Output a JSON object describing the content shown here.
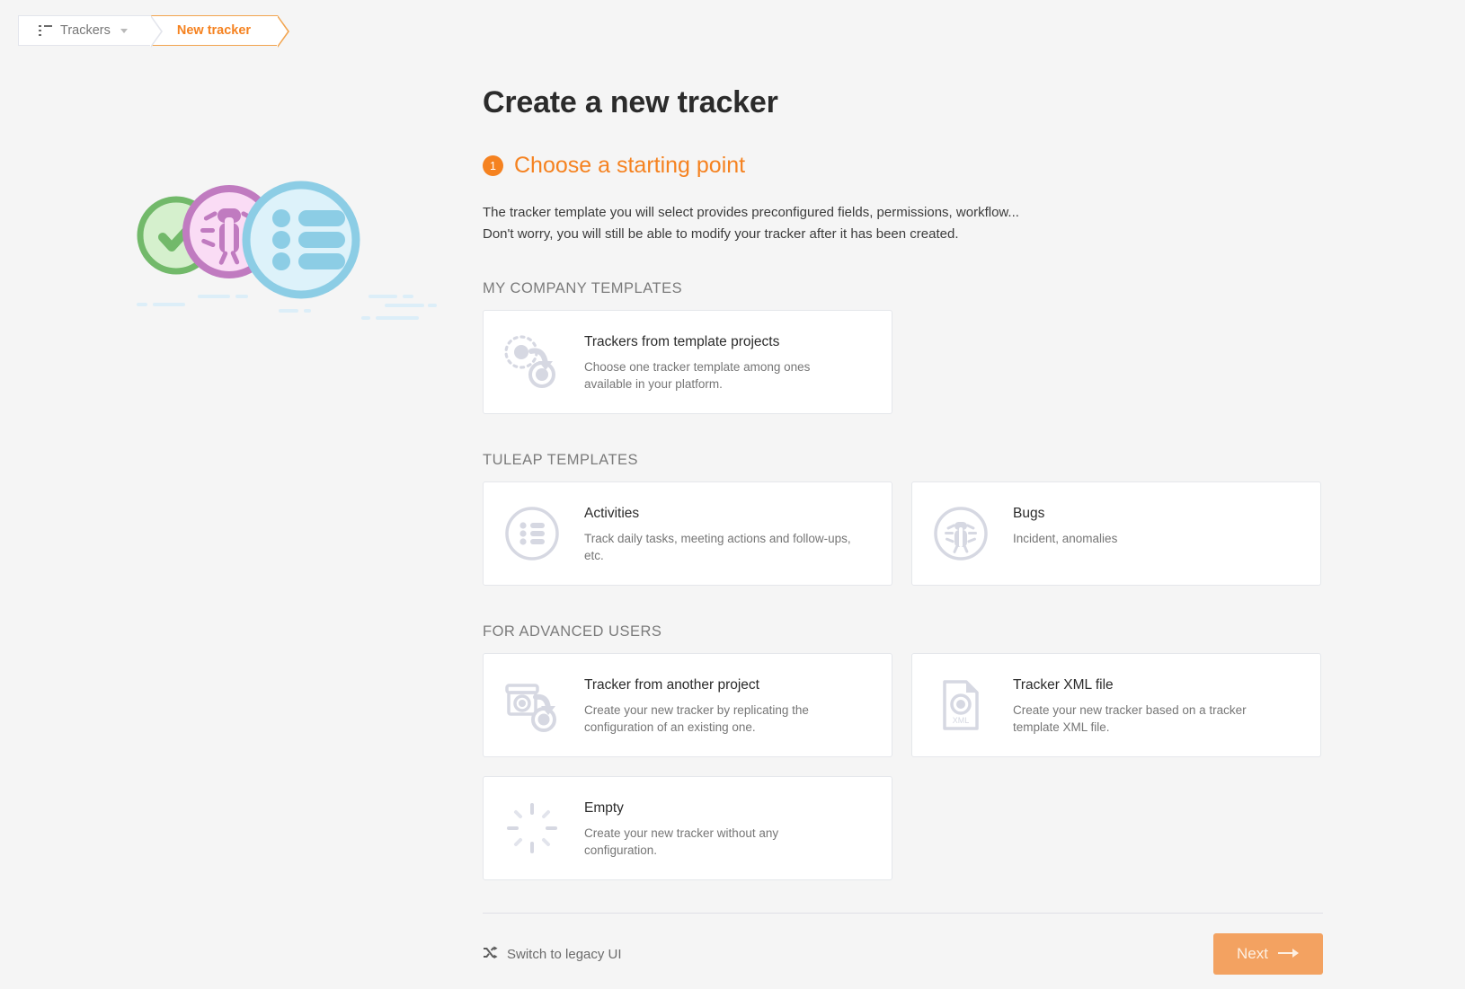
{
  "breadcrumb": {
    "trackers_label": "Trackers",
    "current_label": "New tracker"
  },
  "header": {
    "title": "Create a new tracker",
    "step_number": "1",
    "step_title": "Choose a starting point",
    "intro_line_1": "The tracker template you will select provides preconfigured fields, permissions, workflow...",
    "intro_line_2": "Don't worry, you will still be able to modify your tracker after it has been created."
  },
  "sections": [
    {
      "label": "MY COMPANY TEMPLATES",
      "cards": [
        {
          "icon": "template-projects-icon",
          "title": "Trackers from template projects",
          "desc": "Choose one tracker template among ones available in your platform."
        }
      ]
    },
    {
      "label": "TULEAP TEMPLATES",
      "cards": [
        {
          "icon": "list-circle-icon",
          "title": "Activities",
          "desc": "Track daily tasks, meeting actions and follow-ups, etc."
        },
        {
          "icon": "bug-circle-icon",
          "title": "Bugs",
          "desc": "Incident, anomalies"
        }
      ]
    },
    {
      "label": "FOR ADVANCED USERS",
      "cards": [
        {
          "icon": "another-project-icon",
          "title": "Tracker from another project",
          "desc": "Create your new tracker by replicating the configuration of an existing one."
        },
        {
          "icon": "xml-file-icon",
          "title": "Tracker XML file",
          "desc": "Create your new tracker based on a tracker template XML file."
        },
        {
          "icon": "empty-burst-icon",
          "title": "Empty",
          "desc": "Create your new tracker without any configuration."
        }
      ]
    }
  ],
  "footer": {
    "legacy_label": "Switch to legacy UI",
    "next_label": "Next"
  },
  "icon_labels": {
    "xml": "XML"
  },
  "colors": {
    "accent": "#f58220",
    "next_button": "#f3a261",
    "icon_gray": "#d6d8e2",
    "illustration_green_border": "#72b96a",
    "illustration_green_fill": "#d5f0cd",
    "illustration_pink_border": "#c07bc0",
    "illustration_pink_fill": "#fadcf5",
    "illustration_blue_border": "#8ccde5",
    "illustration_blue_fill": "#ddf2fa"
  }
}
